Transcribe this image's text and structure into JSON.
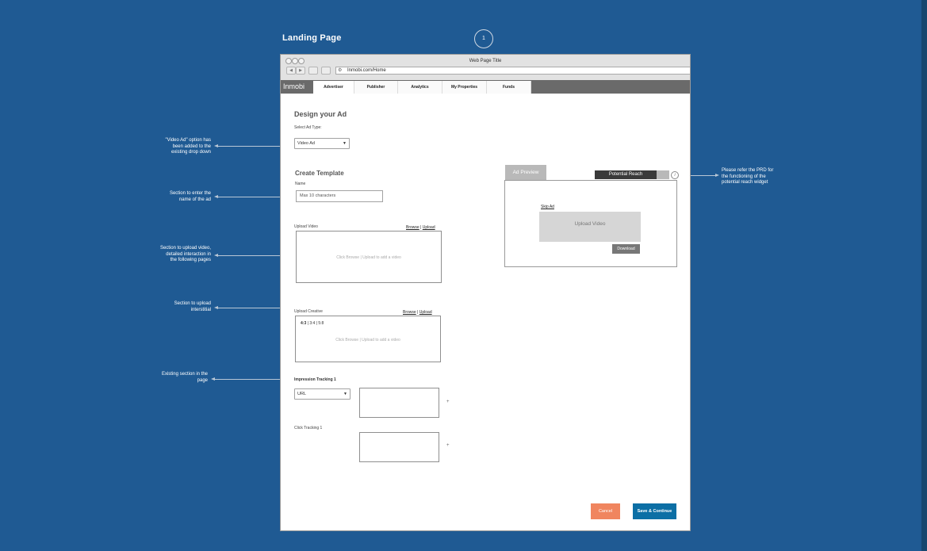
{
  "page": {
    "title": "Landing Page",
    "number": "1"
  },
  "annotations": [
    {
      "lines": [
        "\"Video Ad\" option has",
        "been added to the",
        "existing drop down"
      ]
    },
    {
      "lines": [
        "Section to enter the",
        "name of the ad"
      ]
    },
    {
      "lines": [
        "Section to upload video,",
        "detailed interaction in",
        "the following pages"
      ]
    },
    {
      "lines": [
        "Section to upload",
        "interstitial"
      ]
    },
    {
      "lines": [
        "Existing section in the",
        "page"
      ]
    },
    {
      "lines": [
        "Please refer the PRD for",
        "the functioning of the",
        "potential reach widget"
      ]
    }
  ],
  "browser": {
    "title": "Web Page Title",
    "url": "Inmobi.com/Home",
    "back": "◀",
    "forward": "▶",
    "globe": "⚙"
  },
  "app": {
    "logo": "Inmobi",
    "tabs": [
      "Advertiser",
      "Publisher",
      "Analytics",
      "My Properties",
      "Funds"
    ]
  },
  "form": {
    "heading": "Design your Ad",
    "ad_type_label": "Select Ad Type:",
    "ad_type_value": "Video Ad",
    "template_heading": "Create Template",
    "name_label": "Name",
    "name_placeholder": "Max 10 characters",
    "upload_video_label": "Upload Video",
    "browse": "Browse",
    "upload": "Upload",
    "separator": " | ",
    "video_hint": "Click Browse | Upload to add a video",
    "upload_creative_label": "Upload Creative",
    "ratio_43": "4:3",
    "ratio_34": "3:4",
    "ratio_58": "5:8",
    "creative_hint": "Click Browse | Upload to add a video",
    "impression_label": "Impression Tracking 1",
    "impression_type": "URL",
    "click_label": "Click Tracking 1",
    "plus": "+",
    "caret": "▼"
  },
  "preview": {
    "tab": "Ad Preview",
    "reach": "Potential Reach",
    "info": "i",
    "skip": "Skip Ad",
    "upload_video": "Upload Video",
    "download": "Download"
  },
  "actions": {
    "cancel": "Cancel",
    "save": "Save & Continue"
  }
}
